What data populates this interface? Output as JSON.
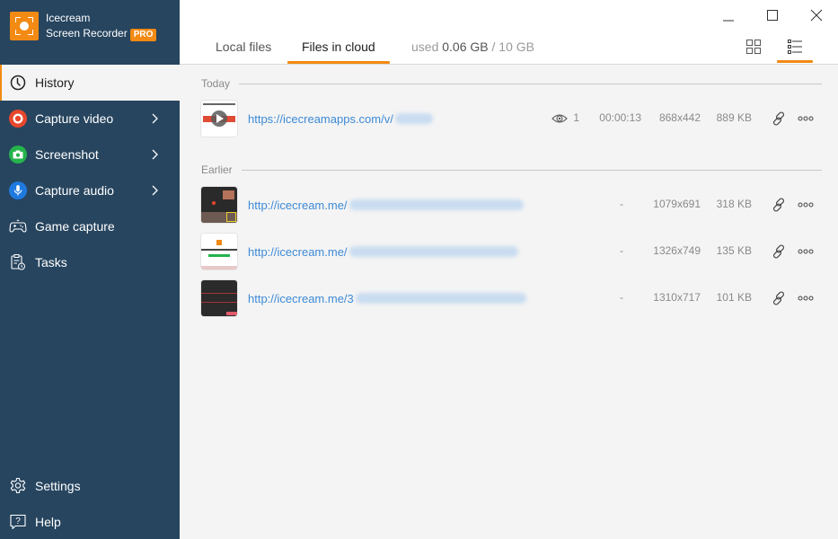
{
  "app": {
    "name_line1": "Icecream",
    "name_line2": "Screen Recorder",
    "badge": "PRO",
    "accent_color": "#f28a13",
    "sidebar_color": "#27455f"
  },
  "sidebar": {
    "items": [
      {
        "label": "History",
        "icon": "clock-icon",
        "active": true
      },
      {
        "label": "Capture video",
        "icon": "record-icon",
        "has_submenu": true
      },
      {
        "label": "Screenshot",
        "icon": "camera-icon",
        "has_submenu": true
      },
      {
        "label": "Capture audio",
        "icon": "microphone-icon",
        "has_submenu": true
      },
      {
        "label": "Game capture",
        "icon": "gamepad-icon"
      },
      {
        "label": "Tasks",
        "icon": "tasks-icon"
      }
    ],
    "bottom_items": [
      {
        "label": "Settings",
        "icon": "gear-icon"
      },
      {
        "label": "Help",
        "icon": "help-icon"
      }
    ]
  },
  "header": {
    "tabs": [
      {
        "label": "Local files",
        "active": false
      },
      {
        "label": "Files in cloud",
        "active": true
      }
    ],
    "usage": {
      "prefix": "used",
      "used": "0.06 GB",
      "separator": "/",
      "total": "10 GB"
    },
    "view_modes": [
      "grid-view",
      "list-view"
    ],
    "active_view": "list-view"
  },
  "history": {
    "sections": [
      {
        "title": "Today",
        "items": [
          {
            "url": "https://icecreamapps.com/v/",
            "views": "1",
            "duration": "00:00:13",
            "resolution": "868x442",
            "size": "889 KB",
            "type": "video"
          }
        ]
      },
      {
        "title": "Earlier",
        "items": [
          {
            "url": "http://icecream.me/",
            "views": "",
            "duration": "-",
            "resolution": "1079x691",
            "size": "318 KB",
            "type": "screenshot"
          },
          {
            "url": "http://icecream.me/",
            "views": "",
            "duration": "-",
            "resolution": "1326x749",
            "size": "135 KB",
            "type": "screenshot"
          },
          {
            "url": "http://icecream.me/3",
            "views": "",
            "duration": "-",
            "resolution": "1310x717",
            "size": "101 KB",
            "type": "screenshot"
          }
        ]
      }
    ]
  }
}
